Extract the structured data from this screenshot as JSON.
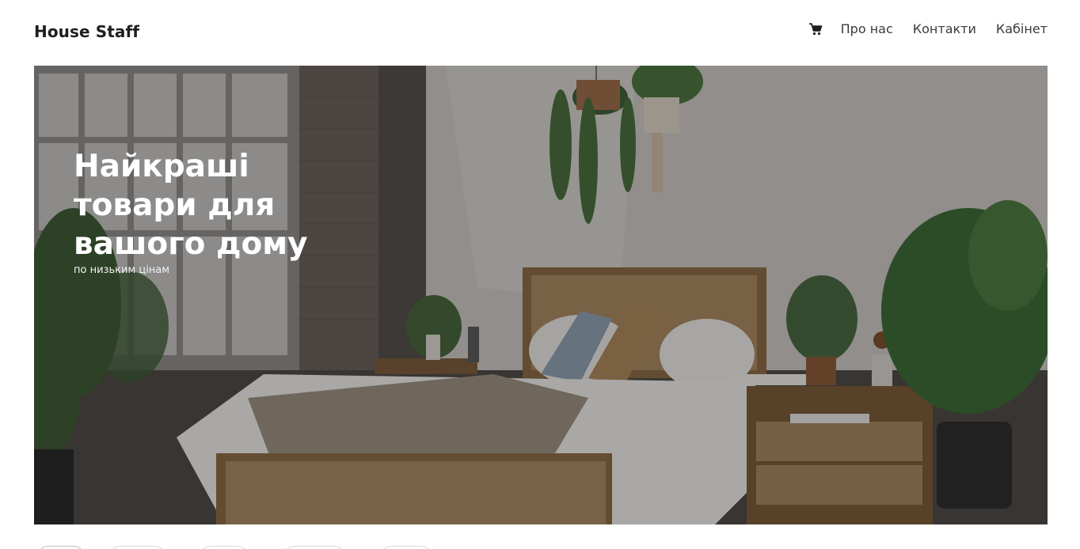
{
  "header": {
    "logo": "House Staff",
    "cart_icon": "shopping-cart-icon",
    "nav": [
      "Про нас",
      "Контакти",
      "Кабінет"
    ]
  },
  "hero": {
    "title": "Найкраші товари для вашого дому",
    "subtitle": "по низьким цінам"
  },
  "colors": {
    "brand_text": "#1e1e1e",
    "hero_text": "#ffffff"
  }
}
